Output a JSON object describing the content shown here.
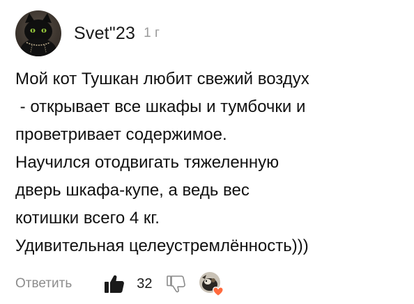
{
  "comment": {
    "author": "Svet\"23",
    "time": "1 г",
    "lines": [
      "Мой кот Тушкан любит свежий воздух",
      " - открывает все шкафы и тумбочки и",
      "проветривает содержимое.",
      "Научился отодвигать тяжеленную",
      "дверь шкафа-купе, а ведь вес",
      "котишки всего 4 кг.",
      "Удивительная целеустремлённость)))"
    ],
    "actions": {
      "reply_label": "Ответить",
      "like_count": "32"
    }
  },
  "icons": {
    "avatar": "black-cat-avatar",
    "like": "thumbs-up-icon",
    "dislike": "thumbs-down-icon",
    "author_like": "author-like-heart-icon"
  },
  "colors": {
    "heart": "#ff6a3d",
    "muted_text": "#8c8c8c"
  }
}
